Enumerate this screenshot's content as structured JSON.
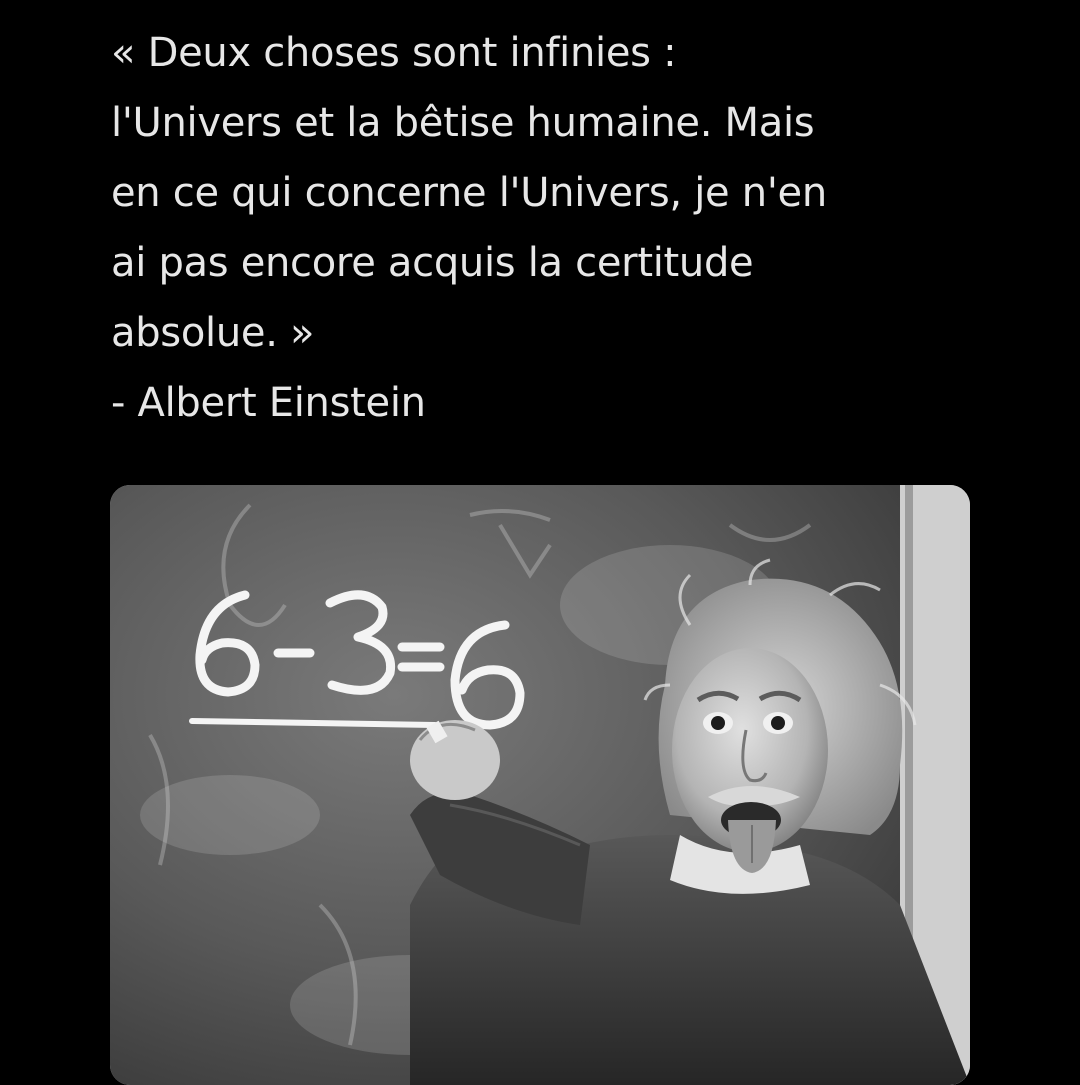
{
  "post": {
    "lines": [
      "« Deux choses sont infinies :",
      "l'Univers et la bêtise humaine. Mais",
      "en ce qui concerne l'Univers, je n'en",
      "ai pas encore acquis la certitude",
      "absolue. »",
      "- Albert Einstein"
    ]
  },
  "media": {
    "chalkboard_equation": "6-3=6",
    "colors": {
      "background": "#000000",
      "text": "#e7e7e7",
      "chalk": "#f4f4f4"
    }
  }
}
